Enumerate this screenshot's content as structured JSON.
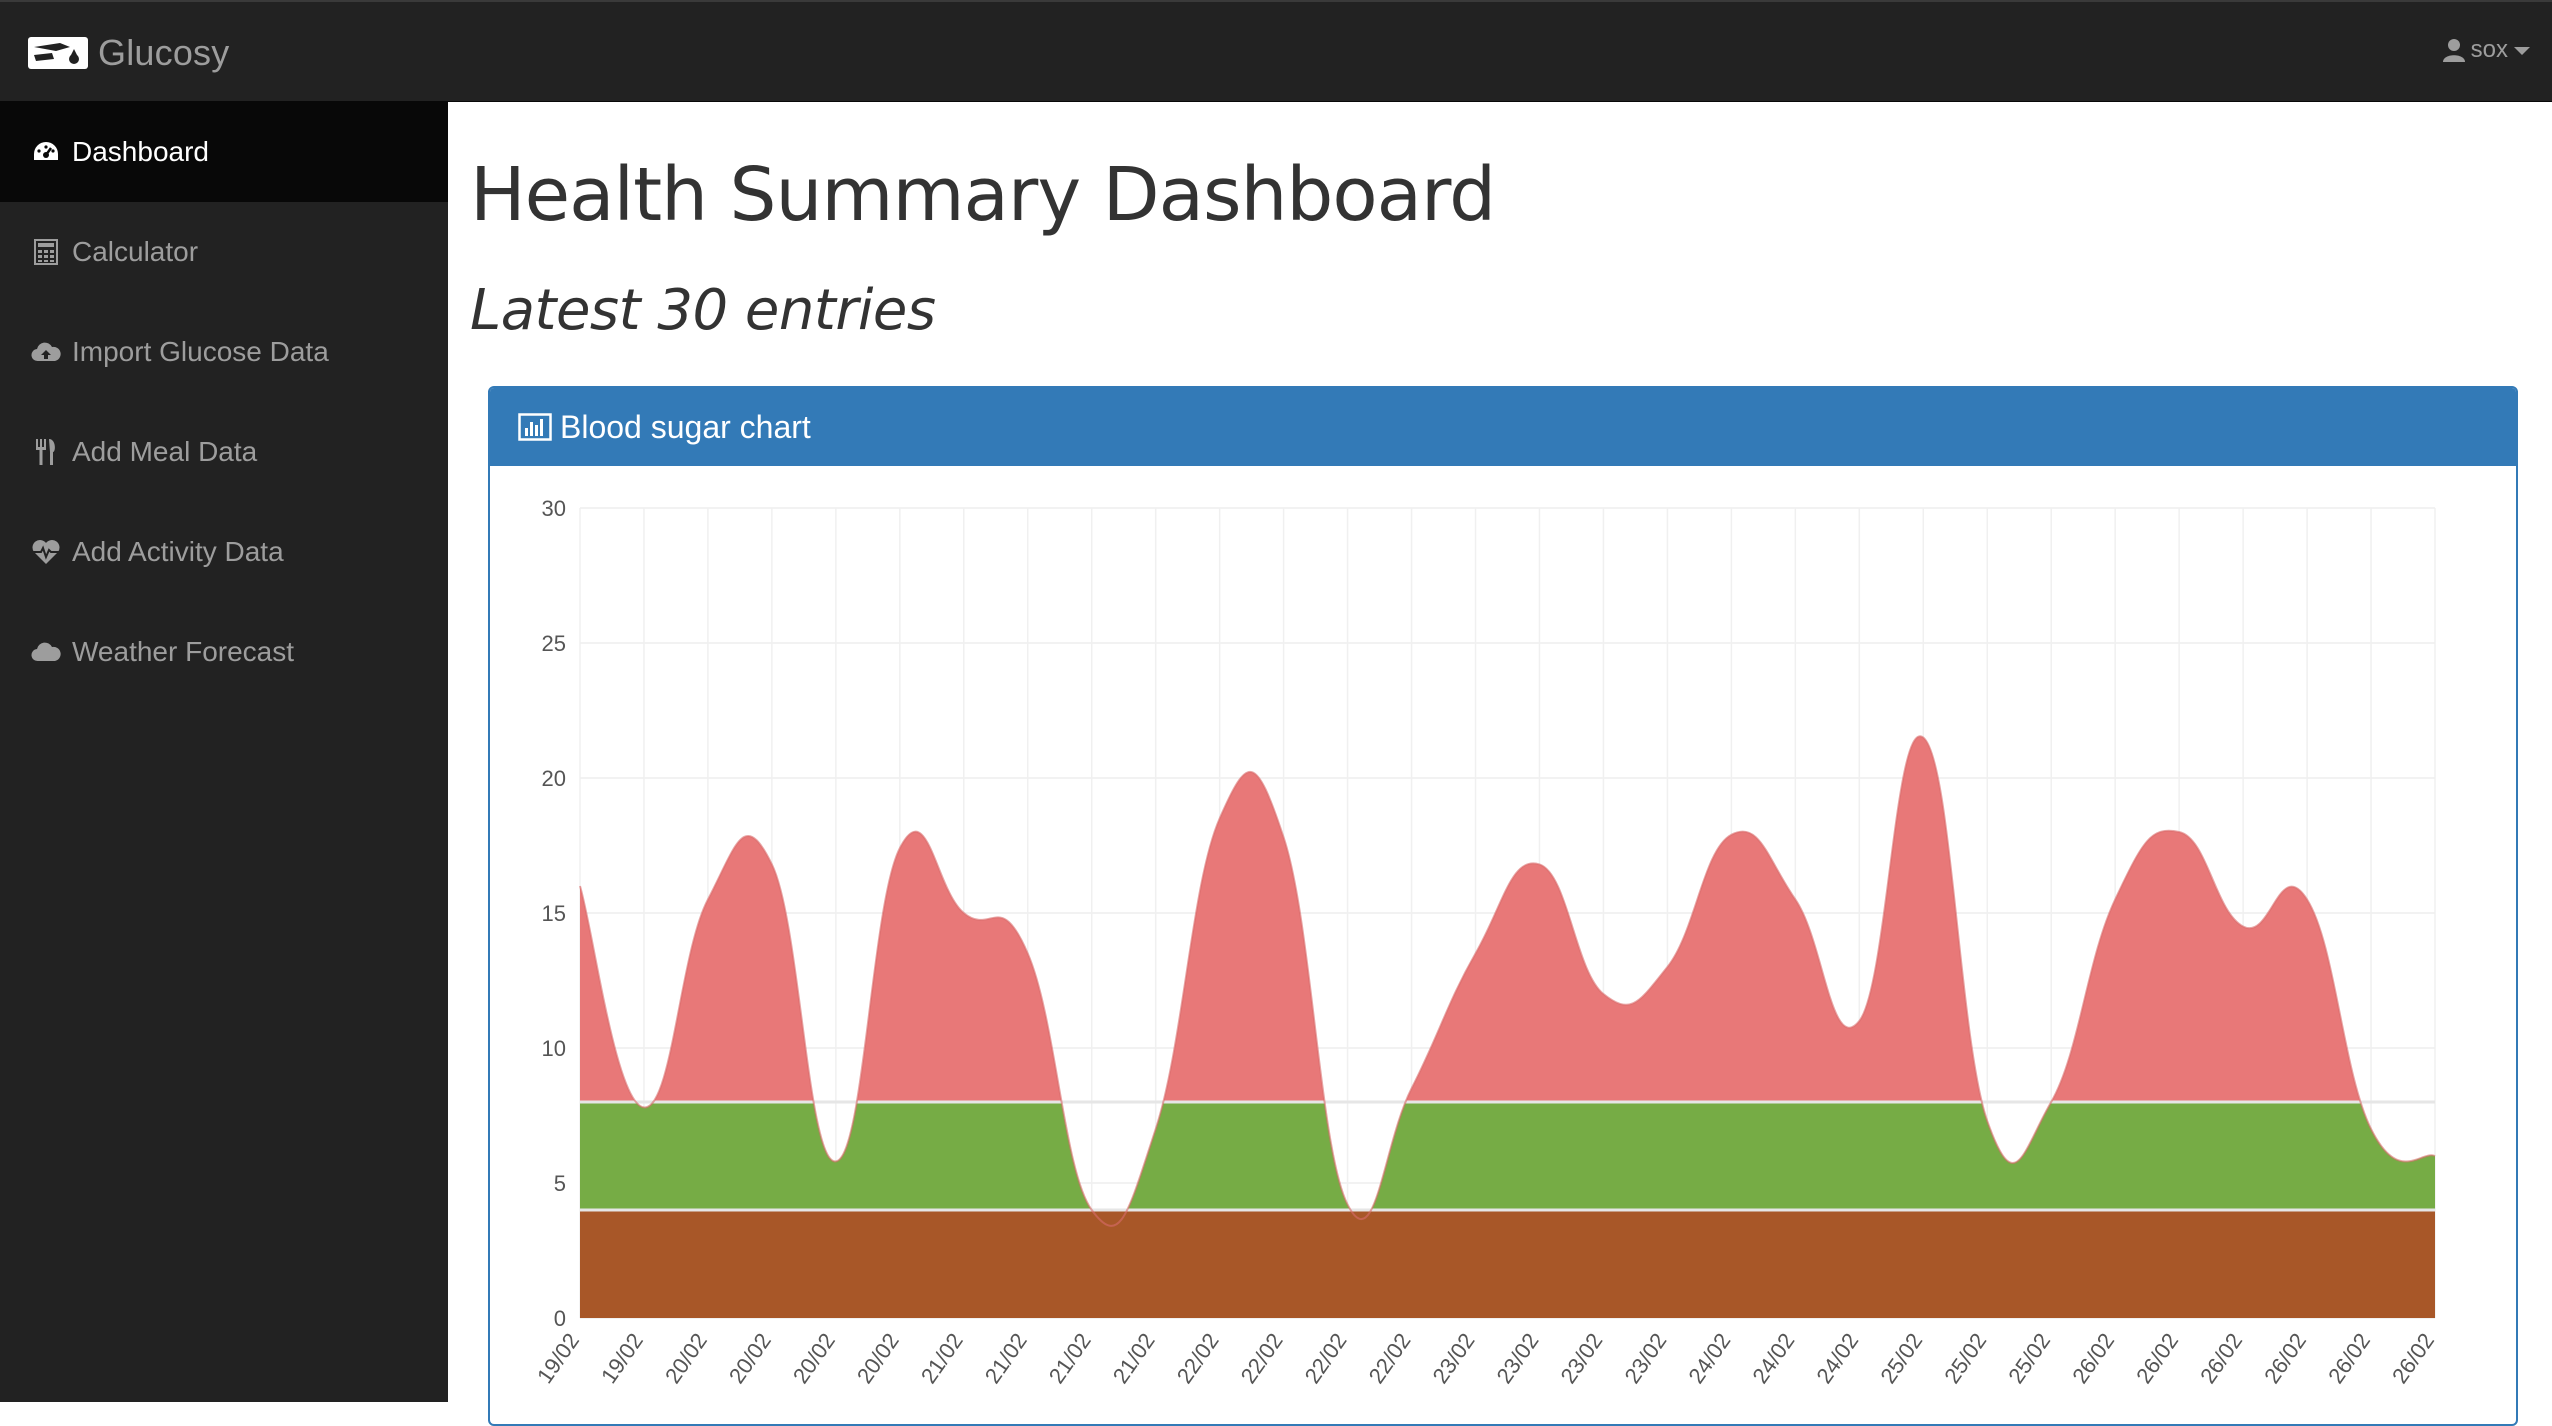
{
  "app": {
    "brand": "Glucosy",
    "user": "sox"
  },
  "sidebar": {
    "items": [
      {
        "label": "Dashboard",
        "icon": "dashboard-icon",
        "active": true
      },
      {
        "label": "Calculator",
        "icon": "calculator-icon",
        "active": false
      },
      {
        "label": "Import Glucose Data",
        "icon": "cloud-upload-icon",
        "active": false
      },
      {
        "label": "Add Meal Data",
        "icon": "cutlery-icon",
        "active": false
      },
      {
        "label": "Add Activity Data",
        "icon": "heartbeat-icon",
        "active": false
      },
      {
        "label": "Weather Forecast",
        "icon": "cloud-icon",
        "active": false
      }
    ]
  },
  "main": {
    "title": "Health Summary Dashboard",
    "subtitle": "Latest 30 entries",
    "panel_title": "Blood sugar chart"
  },
  "colors": {
    "navbar": "#222222",
    "sidebar_active": "#080808",
    "panel": "#337ab7",
    "high": "#e87878",
    "normal_band": "#76ac45",
    "low_band": "#a85728",
    "normal_reading": "#86e87e"
  },
  "chart_data": {
    "type": "area",
    "x": [
      "19/02",
      "19/02",
      "20/02",
      "20/02",
      "20/02",
      "20/02",
      "21/02",
      "21/02",
      "21/02",
      "21/02",
      "22/02",
      "22/02",
      "22/02",
      "22/02",
      "23/02",
      "23/02",
      "23/02",
      "23/02",
      "24/02",
      "24/02",
      "24/02",
      "25/02",
      "25/02",
      "25/02",
      "26/02",
      "26/02",
      "26/02",
      "26/02",
      "26/02",
      "26/02"
    ],
    "series": [
      {
        "values": [
          16.0,
          7.8,
          15.5,
          16.8,
          5.8,
          17.4,
          15.0,
          13.5,
          4.0,
          7.0,
          18.5,
          17.8,
          4.2,
          8.5,
          13.5,
          16.8,
          12.0,
          13.0,
          17.9,
          15.5,
          11.0,
          21.5,
          7.3,
          8.0,
          15.5,
          18.0,
          14.5,
          15.5,
          7.0,
          6.0
        ]
      }
    ],
    "bands": [
      {
        "from": 0,
        "to": 4
      },
      {
        "from": 4,
        "to": 8
      }
    ],
    "ylim": [
      0,
      30
    ],
    "yticks": [
      0,
      5,
      10,
      15,
      20,
      25,
      30
    ],
    "grid": true
  }
}
